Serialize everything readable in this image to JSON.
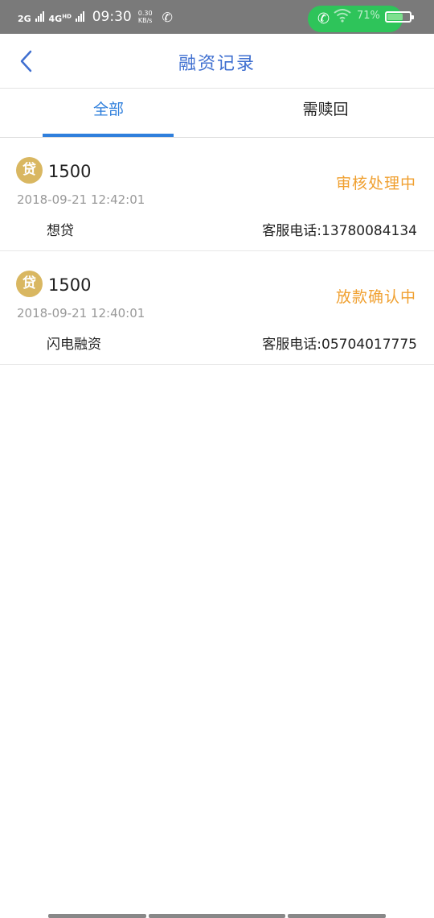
{
  "status_bar": {
    "net1": "2G",
    "net2": "4G",
    "net2_sup": "HD",
    "time": "09:30",
    "speed_value": "0.30",
    "speed_unit": "KB/s",
    "battery_text": "71%",
    "call_pill_color": "#2ec45a",
    "call_icon": "phone-icon",
    "wifi_icon": "wifi-icon",
    "battery_icon": "battery-icon"
  },
  "nav": {
    "title": "融资记录",
    "back_icon": "chevron-left-icon",
    "title_color": "#3f6fd0"
  },
  "tabs": [
    {
      "label": "全部",
      "active": true
    },
    {
      "label": "需赎回",
      "active": false
    }
  ],
  "accent_color": "#2f7fdc",
  "status_color": "#f0a030",
  "records": [
    {
      "badge": "贷",
      "amount": "1500",
      "status": "审核处理中",
      "datetime": "2018-09-21 12:42:01",
      "lender": "想贷",
      "service": "客服电话:13780084134"
    },
    {
      "badge": "贷",
      "amount": "1500",
      "status": "放款确认中",
      "datetime": "2018-09-21 12:40:01",
      "lender": "闪电融资",
      "service": "客服电话:05704017775"
    }
  ]
}
